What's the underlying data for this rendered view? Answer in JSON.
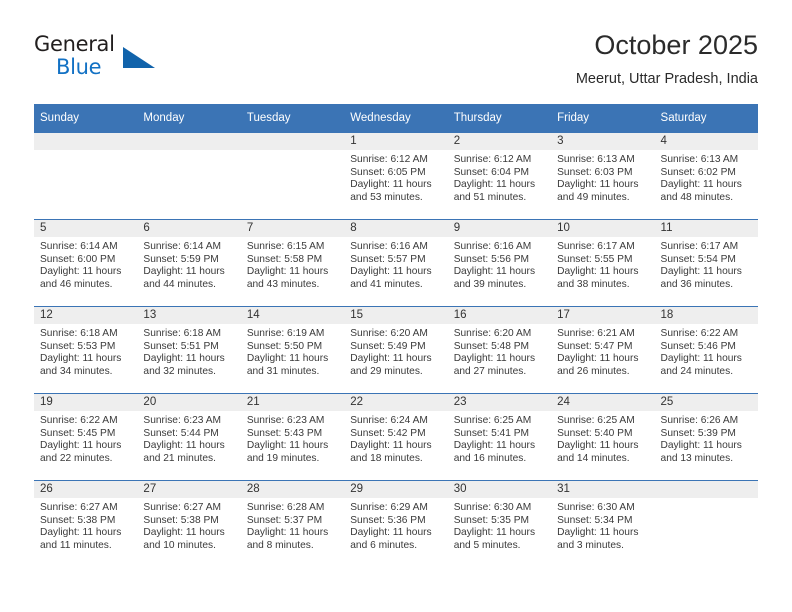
{
  "brand": {
    "name_top": "General",
    "name_bottom": "Blue",
    "triangle_icon": "triangle-icon",
    "color_dark": "#221f1f",
    "color_blue": "#1271c4"
  },
  "header": {
    "title": "October 2025",
    "subtitle": "Meerut, Uttar Pradesh, India"
  },
  "theme": {
    "header_blue": "#3b74b5",
    "daynum_band": "#eeeeee"
  },
  "calendar": {
    "weekday_headers": [
      "Sunday",
      "Monday",
      "Tuesday",
      "Wednesday",
      "Thursday",
      "Friday",
      "Saturday"
    ],
    "weeks": [
      [
        {
          "day": "",
          "empty": true,
          "lines": []
        },
        {
          "day": "",
          "empty": true,
          "lines": []
        },
        {
          "day": "",
          "empty": true,
          "lines": []
        },
        {
          "day": "1",
          "empty": false,
          "lines": [
            "Sunrise: 6:12 AM",
            "Sunset: 6:05 PM",
            "Daylight: 11 hours",
            "and 53 minutes."
          ]
        },
        {
          "day": "2",
          "empty": false,
          "lines": [
            "Sunrise: 6:12 AM",
            "Sunset: 6:04 PM",
            "Daylight: 11 hours",
            "and 51 minutes."
          ]
        },
        {
          "day": "3",
          "empty": false,
          "lines": [
            "Sunrise: 6:13 AM",
            "Sunset: 6:03 PM",
            "Daylight: 11 hours",
            "and 49 minutes."
          ]
        },
        {
          "day": "4",
          "empty": false,
          "lines": [
            "Sunrise: 6:13 AM",
            "Sunset: 6:02 PM",
            "Daylight: 11 hours",
            "and 48 minutes."
          ]
        }
      ],
      [
        {
          "day": "5",
          "empty": false,
          "lines": [
            "Sunrise: 6:14 AM",
            "Sunset: 6:00 PM",
            "Daylight: 11 hours",
            "and 46 minutes."
          ]
        },
        {
          "day": "6",
          "empty": false,
          "lines": [
            "Sunrise: 6:14 AM",
            "Sunset: 5:59 PM",
            "Daylight: 11 hours",
            "and 44 minutes."
          ]
        },
        {
          "day": "7",
          "empty": false,
          "lines": [
            "Sunrise: 6:15 AM",
            "Sunset: 5:58 PM",
            "Daylight: 11 hours",
            "and 43 minutes."
          ]
        },
        {
          "day": "8",
          "empty": false,
          "lines": [
            "Sunrise: 6:16 AM",
            "Sunset: 5:57 PM",
            "Daylight: 11 hours",
            "and 41 minutes."
          ]
        },
        {
          "day": "9",
          "empty": false,
          "lines": [
            "Sunrise: 6:16 AM",
            "Sunset: 5:56 PM",
            "Daylight: 11 hours",
            "and 39 minutes."
          ]
        },
        {
          "day": "10",
          "empty": false,
          "lines": [
            "Sunrise: 6:17 AM",
            "Sunset: 5:55 PM",
            "Daylight: 11 hours",
            "and 38 minutes."
          ]
        },
        {
          "day": "11",
          "empty": false,
          "lines": [
            "Sunrise: 6:17 AM",
            "Sunset: 5:54 PM",
            "Daylight: 11 hours",
            "and 36 minutes."
          ]
        }
      ],
      [
        {
          "day": "12",
          "empty": false,
          "lines": [
            "Sunrise: 6:18 AM",
            "Sunset: 5:53 PM",
            "Daylight: 11 hours",
            "and 34 minutes."
          ]
        },
        {
          "day": "13",
          "empty": false,
          "lines": [
            "Sunrise: 6:18 AM",
            "Sunset: 5:51 PM",
            "Daylight: 11 hours",
            "and 32 minutes."
          ]
        },
        {
          "day": "14",
          "empty": false,
          "lines": [
            "Sunrise: 6:19 AM",
            "Sunset: 5:50 PM",
            "Daylight: 11 hours",
            "and 31 minutes."
          ]
        },
        {
          "day": "15",
          "empty": false,
          "lines": [
            "Sunrise: 6:20 AM",
            "Sunset: 5:49 PM",
            "Daylight: 11 hours",
            "and 29 minutes."
          ]
        },
        {
          "day": "16",
          "empty": false,
          "lines": [
            "Sunrise: 6:20 AM",
            "Sunset: 5:48 PM",
            "Daylight: 11 hours",
            "and 27 minutes."
          ]
        },
        {
          "day": "17",
          "empty": false,
          "lines": [
            "Sunrise: 6:21 AM",
            "Sunset: 5:47 PM",
            "Daylight: 11 hours",
            "and 26 minutes."
          ]
        },
        {
          "day": "18",
          "empty": false,
          "lines": [
            "Sunrise: 6:22 AM",
            "Sunset: 5:46 PM",
            "Daylight: 11 hours",
            "and 24 minutes."
          ]
        }
      ],
      [
        {
          "day": "19",
          "empty": false,
          "lines": [
            "Sunrise: 6:22 AM",
            "Sunset: 5:45 PM",
            "Daylight: 11 hours",
            "and 22 minutes."
          ]
        },
        {
          "day": "20",
          "empty": false,
          "lines": [
            "Sunrise: 6:23 AM",
            "Sunset: 5:44 PM",
            "Daylight: 11 hours",
            "and 21 minutes."
          ]
        },
        {
          "day": "21",
          "empty": false,
          "lines": [
            "Sunrise: 6:23 AM",
            "Sunset: 5:43 PM",
            "Daylight: 11 hours",
            "and 19 minutes."
          ]
        },
        {
          "day": "22",
          "empty": false,
          "lines": [
            "Sunrise: 6:24 AM",
            "Sunset: 5:42 PM",
            "Daylight: 11 hours",
            "and 18 minutes."
          ]
        },
        {
          "day": "23",
          "empty": false,
          "lines": [
            "Sunrise: 6:25 AM",
            "Sunset: 5:41 PM",
            "Daylight: 11 hours",
            "and 16 minutes."
          ]
        },
        {
          "day": "24",
          "empty": false,
          "lines": [
            "Sunrise: 6:25 AM",
            "Sunset: 5:40 PM",
            "Daylight: 11 hours",
            "and 14 minutes."
          ]
        },
        {
          "day": "25",
          "empty": false,
          "lines": [
            "Sunrise: 6:26 AM",
            "Sunset: 5:39 PM",
            "Daylight: 11 hours",
            "and 13 minutes."
          ]
        }
      ],
      [
        {
          "day": "26",
          "empty": false,
          "lines": [
            "Sunrise: 6:27 AM",
            "Sunset: 5:38 PM",
            "Daylight: 11 hours",
            "and 11 minutes."
          ]
        },
        {
          "day": "27",
          "empty": false,
          "lines": [
            "Sunrise: 6:27 AM",
            "Sunset: 5:38 PM",
            "Daylight: 11 hours",
            "and 10 minutes."
          ]
        },
        {
          "day": "28",
          "empty": false,
          "lines": [
            "Sunrise: 6:28 AM",
            "Sunset: 5:37 PM",
            "Daylight: 11 hours",
            "and 8 minutes."
          ]
        },
        {
          "day": "29",
          "empty": false,
          "lines": [
            "Sunrise: 6:29 AM",
            "Sunset: 5:36 PM",
            "Daylight: 11 hours",
            "and 6 minutes."
          ]
        },
        {
          "day": "30",
          "empty": false,
          "lines": [
            "Sunrise: 6:30 AM",
            "Sunset: 5:35 PM",
            "Daylight: 11 hours",
            "and 5 minutes."
          ]
        },
        {
          "day": "31",
          "empty": false,
          "lines": [
            "Sunrise: 6:30 AM",
            "Sunset: 5:34 PM",
            "Daylight: 11 hours",
            "and 3 minutes."
          ]
        },
        {
          "day": "",
          "empty": true,
          "lines": []
        }
      ]
    ]
  }
}
